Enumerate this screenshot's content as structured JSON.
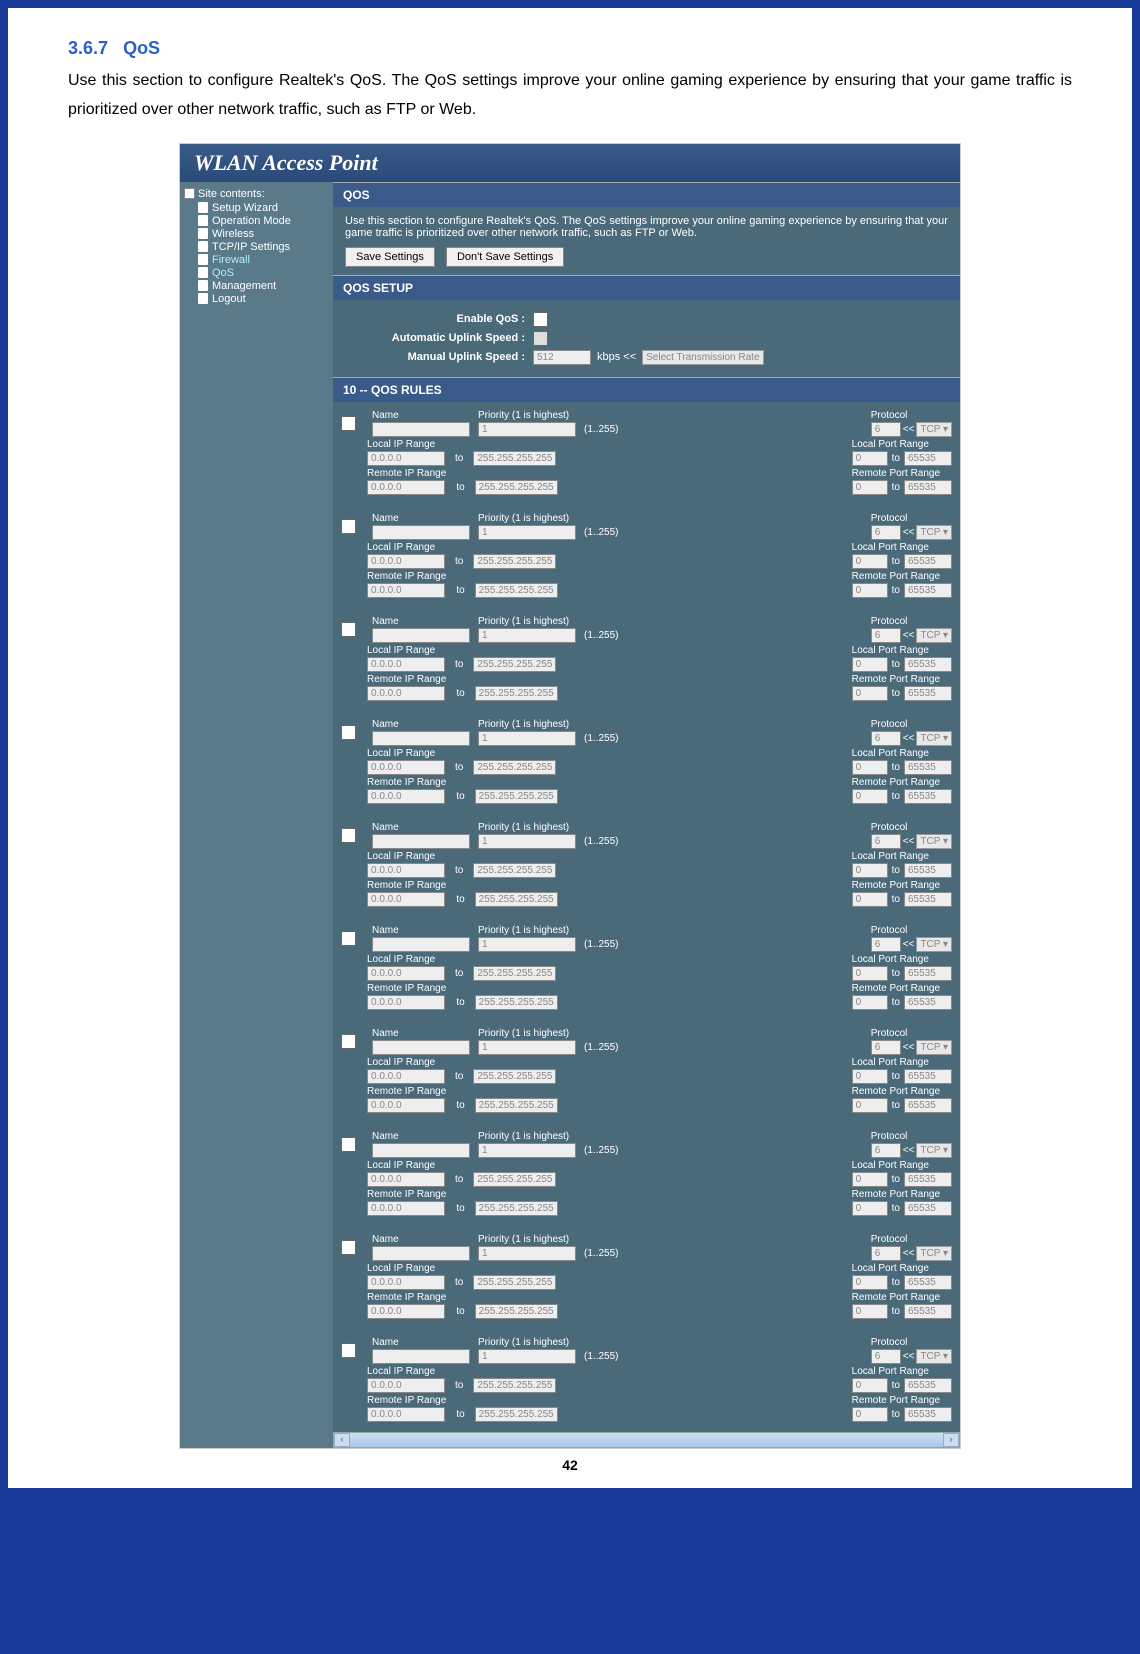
{
  "section": {
    "number": "3.6.7",
    "title": "QoS"
  },
  "intro": "Use this section to configure Realtek's QoS. The QoS settings improve your online gaming experience by ensuring that your game traffic is prioritized over other network traffic, such as FTP or Web.",
  "ap_title": "WLAN Access Point",
  "sidebar": {
    "header": "Site contents:",
    "items": [
      "Setup Wizard",
      "Operation Mode",
      "Wireless",
      "TCP/IP Settings",
      "Firewall",
      "QoS",
      "Management",
      "Logout"
    ]
  },
  "qos_panel": {
    "title": "QOS",
    "desc": "Use this section to configure Realtek's QoS. The QoS settings improve your online gaming experience by ensuring that your game traffic is prioritized over other network traffic, such as FTP or Web.",
    "save_btn": "Save Settings",
    "dont_save_btn": "Don't Save Settings"
  },
  "qos_setup": {
    "title": "QOS SETUP",
    "enable_lbl": "Enable QoS :",
    "auto_lbl": "Automatic Uplink Speed :",
    "manual_lbl": "Manual Uplink Speed :",
    "manual_val": "512",
    "kbps": "kbps  <<",
    "rate_sel": "Select Transmission Rate"
  },
  "rules": {
    "title": "10 -- QOS RULES",
    "labels": {
      "name": "Name",
      "priority": "Priority (1 is highest)",
      "range_note": "(1..255)",
      "protocol": "Protocol",
      "arrow": "<<",
      "proto_val": "TCP",
      "local_ip": "Local IP Range",
      "remote_ip": "Remote IP Range",
      "local_port": "Local Port Range",
      "remote_port": "Remote Port Range",
      "to": "to",
      "ip_from": "0.0.0.0",
      "ip_to": "255.255.255.255",
      "port_from": "0",
      "port_to": "65535",
      "proto_num": "6",
      "prio_val": "1"
    },
    "count": 10
  },
  "page_number": "42"
}
